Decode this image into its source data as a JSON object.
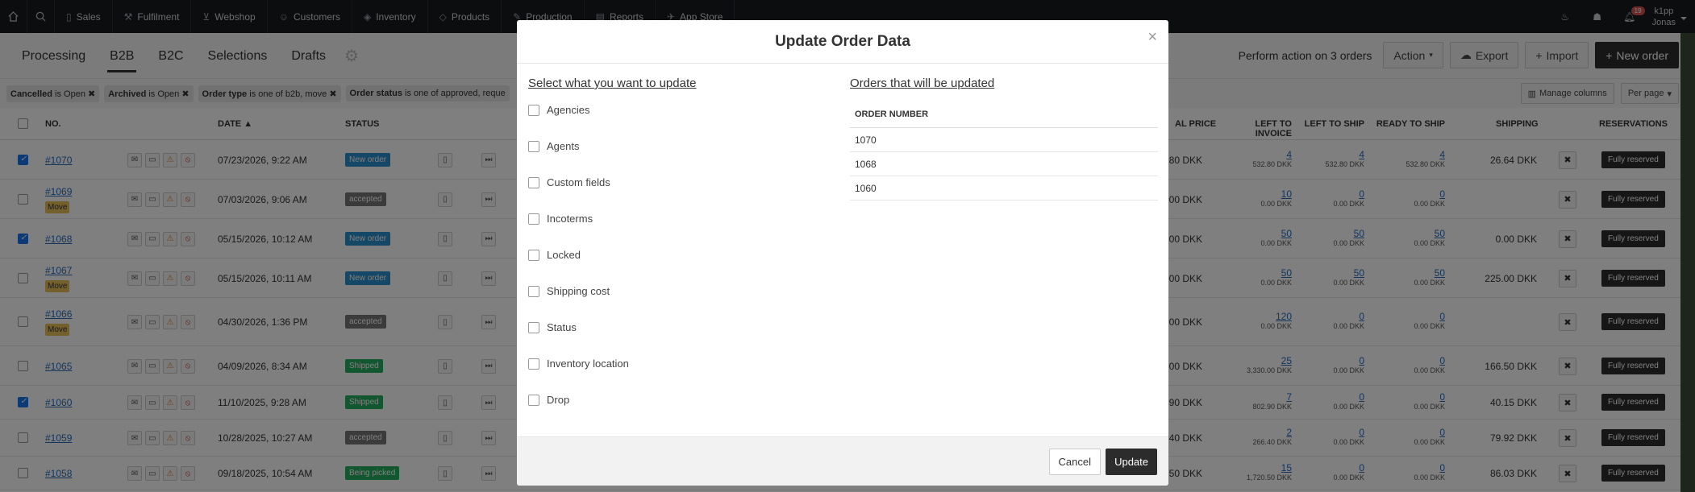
{
  "topnav": {
    "items": [
      {
        "label": "Sales",
        "icon": "document-icon"
      },
      {
        "label": "Fulfilment",
        "icon": "wrench-icon"
      },
      {
        "label": "Webshop",
        "icon": "cart-icon"
      },
      {
        "label": "Customers",
        "icon": "users-icon"
      },
      {
        "label": "Inventory",
        "icon": "layers-icon"
      },
      {
        "label": "Products",
        "icon": "tag-icon"
      },
      {
        "label": "Production",
        "icon": "pencil-icon"
      },
      {
        "label": "Reports",
        "icon": "chart-icon"
      },
      {
        "label": "App Store",
        "icon": "app-icon"
      }
    ],
    "notification_count": "19",
    "user_line1": "k1pp",
    "user_line2": "Jonas"
  },
  "subnav": {
    "tabs": [
      "Processing",
      "B2B",
      "B2C",
      "Selections",
      "Drafts"
    ],
    "active_tab": "B2B",
    "perform_text": "Perform action on 3 orders",
    "action_label": "Action",
    "export_label": "Export",
    "import_label": "Import",
    "new_order_label": "New order"
  },
  "filters": {
    "chips": [
      {
        "key": "Cancelled",
        "rest": " is Open"
      },
      {
        "key": "Archived",
        "rest": " is Open"
      },
      {
        "key": "Order type",
        "rest": " is one of b2b, move"
      },
      {
        "key": "Order status",
        "rest": " is one of approved, reque"
      }
    ],
    "manage_columns": "Manage columns",
    "per_page": "Per page"
  },
  "table": {
    "headers": {
      "no": "NO.",
      "date": "DATE",
      "status": "STATUS",
      "total_price_partial": "AL PRICE",
      "left_to_invoice": "LEFT TO INVOICE",
      "left_to_ship": "LEFT TO SHIP",
      "ready_to_ship": "READY TO SHIP",
      "shipping": "SHIPPING",
      "reservations": "RESERVATIONS"
    },
    "rows": [
      {
        "no": "#1070",
        "move": "",
        "date": "07/23/2026, 9:22 AM",
        "status": "New order",
        "price": "80 DKK",
        "inv": "4",
        "inv_sub": "532.80 DKK",
        "ship": "4",
        "ship_sub": "532.80 DKK",
        "ready": "4",
        "ready_sub": "532.80 DKK",
        "shipping": "26.64 DKK",
        "res": "Fully reserved"
      },
      {
        "no": "#1069",
        "move": "Move",
        "date": "07/03/2026, 9:06 AM",
        "status": "accepted",
        "price": "00 DKK",
        "inv": "10",
        "inv_sub": "0.00 DKK",
        "ship": "0",
        "ship_sub": "0.00 DKK",
        "ready": "0",
        "ready_sub": "0.00 DKK",
        "shipping": "",
        "res": "Fully reserved"
      },
      {
        "no": "#1068",
        "move": "",
        "date": "05/15/2026, 10:12 AM",
        "status": "New order",
        "price": "00 DKK",
        "inv": "50",
        "inv_sub": "0.00 DKK",
        "ship": "50",
        "ship_sub": "0.00 DKK",
        "ready": "50",
        "ready_sub": "0.00 DKK",
        "shipping": "0.00 DKK",
        "res": "Fully reserved"
      },
      {
        "no": "#1067",
        "move": "Move",
        "date": "05/15/2026, 10:11 AM",
        "status": "New order",
        "price": "00 DKK",
        "inv": "50",
        "inv_sub": "0.00 DKK",
        "ship": "50",
        "ship_sub": "0.00 DKK",
        "ready": "50",
        "ready_sub": "0.00 DKK",
        "shipping": "225.00 DKK",
        "res": "Fully reserved"
      },
      {
        "no": "#1066",
        "move": "Move",
        "date": "04/30/2026, 1:36 PM",
        "status": "accepted",
        "price": "00 DKK",
        "inv": "120",
        "inv_sub": "0.00 DKK",
        "ship": "0",
        "ship_sub": "0.00 DKK",
        "ready": "0",
        "ready_sub": "0.00 DKK",
        "shipping": "",
        "res": "Fully reserved"
      },
      {
        "no": "#1065",
        "move": "",
        "date": "04/09/2026, 8:34 AM",
        "status": "Shipped",
        "price": "00 DKK",
        "inv": "25",
        "inv_sub": "3,330.00 DKK",
        "ship": "0",
        "ship_sub": "0.00 DKK",
        "ready": "0",
        "ready_sub": "0.00 DKK",
        "shipping": "166.50 DKK",
        "res": "Fully reserved"
      },
      {
        "no": "#1060",
        "move": "",
        "date": "11/10/2025, 9:28 AM",
        "status": "Shipped",
        "price": "90 DKK",
        "inv": "7",
        "inv_sub": "802.90 DKK",
        "ship": "0",
        "ship_sub": "0.00 DKK",
        "ready": "0",
        "ready_sub": "0.00 DKK",
        "shipping": "40.15 DKK",
        "res": "Fully reserved"
      },
      {
        "no": "#1059",
        "move": "",
        "date": "10/28/2025, 10:27 AM",
        "status": "accepted",
        "price": "40 DKK",
        "inv": "2",
        "inv_sub": "266.40 DKK",
        "ship": "0",
        "ship_sub": "0.00 DKK",
        "ready": "0",
        "ready_sub": "0.00 DKK",
        "shipping": "79.92 DKK",
        "res": "Fully reserved"
      },
      {
        "no": "#1058",
        "move": "",
        "date": "09/18/2025, 10:54 AM",
        "status": "Being picked",
        "price": "50 DKK",
        "inv": "15",
        "inv_sub": "1,720.50 DKK",
        "ship": "0",
        "ship_sub": "0.00 DKK",
        "ready": "0",
        "ready_sub": "0.00 DKK",
        "shipping": "86.03 DKK",
        "res": "Fully reserved"
      }
    ]
  },
  "modal": {
    "title": "Update Order Data",
    "left_heading": "Select what you want to update",
    "options": [
      "Agencies",
      "Agents",
      "Custom fields",
      "Incoterms",
      "Locked",
      "Shipping cost",
      "Status",
      "Inventory location",
      "Drop"
    ],
    "right_heading": "Orders that will be updated",
    "orders_header": "ORDER NUMBER",
    "orders": [
      "1070",
      "1068",
      "1060"
    ],
    "cancel_label": "Cancel",
    "update_label": "Update"
  }
}
